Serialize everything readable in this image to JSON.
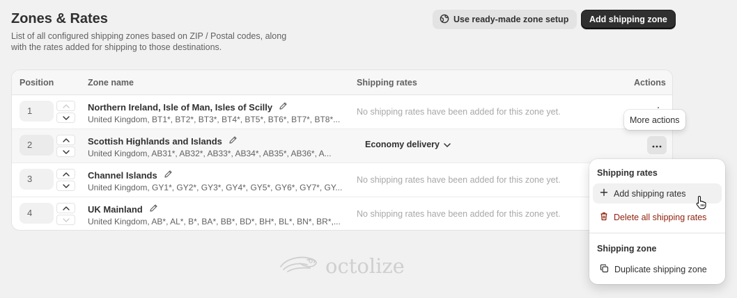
{
  "header": {
    "title": "Zones & Rates",
    "description": "List of all configured shipping zones based on ZIP / Postal codes, along with the rates added for shipping to those destinations.",
    "ready_made_label": "Use ready-made zone setup",
    "add_zone_label": "Add shipping zone"
  },
  "table": {
    "columns": [
      "Position",
      "Zone name",
      "Shipping rates",
      "Actions"
    ],
    "rows": [
      {
        "position": "1",
        "name": "Northern Ireland, Isle of Man, Isles of Scilly",
        "regions": "United Kingdom, BT1*, BT2*, BT3*, BT4*, BT5*, BT6*, BT7*, BT8*...",
        "rates": "No shipping rates have been added for this zone yet."
      },
      {
        "position": "2",
        "name": "Scottish Highlands and Islands",
        "regions": "United Kingdom, AB31*, AB32*, AB33*, AB34*, AB35*, AB36*, A...",
        "rates": "Economy delivery"
      },
      {
        "position": "3",
        "name": "Channel Islands",
        "regions": "United Kingdom, GY1*, GY2*, GY3*, GY4*, GY5*, GY6*, GY7*, GY...",
        "rates": "No shipping rates have been added for this zone yet."
      },
      {
        "position": "4",
        "name": "UK Mainland",
        "regions": "United Kingdom, AB*, AL*, B*, BA*, BB*, BD*, BH*, BL*, BN*, BR*,...",
        "rates": "No shipping rates have been added for this zone yet."
      }
    ]
  },
  "tooltip": "More actions",
  "popover": {
    "rates_section": "Shipping rates",
    "add_rates": "Add shipping rates",
    "delete_rates": "Delete all shipping rates",
    "zone_section": "Shipping zone",
    "duplicate_zone": "Duplicate shipping zone"
  },
  "watermark": "octolize",
  "colors": {
    "primary": "#303030",
    "danger": "#8e1f0b",
    "muted": "#a8a8a8"
  }
}
